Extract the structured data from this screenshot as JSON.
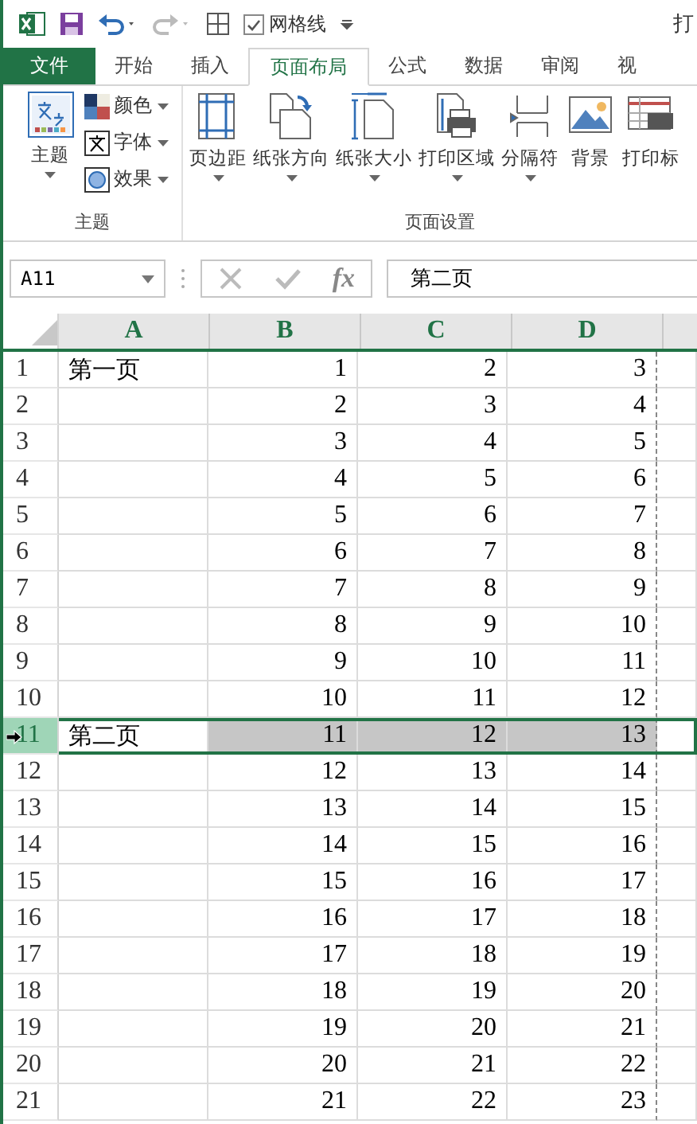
{
  "quick_access": {
    "gridlines": {
      "label": "网格线",
      "checked": true
    }
  },
  "title": "打",
  "tabs": [
    {
      "label": "文件",
      "kind": "file",
      "selected": false
    },
    {
      "label": "开始",
      "kind": "tab",
      "selected": false
    },
    {
      "label": "插入",
      "kind": "tab",
      "selected": false
    },
    {
      "label": "页面布局",
      "kind": "tab",
      "selected": true
    },
    {
      "label": "公式",
      "kind": "tab",
      "selected": false
    },
    {
      "label": "数据",
      "kind": "tab",
      "selected": false
    },
    {
      "label": "审阅",
      "kind": "tab",
      "selected": false
    },
    {
      "label": "视",
      "kind": "tab",
      "selected": false
    }
  ],
  "ribbon": {
    "theme_group": {
      "label": "主题",
      "theme_button": "主题",
      "small_buttons": [
        {
          "label": "颜色",
          "kind": "colors"
        },
        {
          "label": "字体",
          "kind": "fonts"
        },
        {
          "label": "效果",
          "kind": "effects"
        }
      ]
    },
    "page_setup_group": {
      "label": "页面设置",
      "buttons": [
        {
          "label": "页边距",
          "kind": "margins",
          "dropdown": true
        },
        {
          "label": "纸张方向",
          "kind": "orientation",
          "dropdown": true
        },
        {
          "label": "纸张大小",
          "kind": "size",
          "dropdown": true
        },
        {
          "label": "打印区域",
          "kind": "print-area",
          "dropdown": true
        },
        {
          "label": "分隔符",
          "kind": "breaks",
          "dropdown": true
        },
        {
          "label": "背景",
          "kind": "background",
          "dropdown": false
        },
        {
          "label": "打印标",
          "kind": "print-titles",
          "dropdown": false
        }
      ]
    }
  },
  "formula_bar": {
    "name_box": "A11",
    "function_button": "fx",
    "formula": "第二页"
  },
  "sheet": {
    "columns": [
      "A",
      "B",
      "C",
      "D"
    ],
    "rows": [
      {
        "header": "1",
        "cells": [
          "第一页",
          "1",
          "2",
          "3"
        ],
        "selected": false
      },
      {
        "header": "2",
        "cells": [
          "",
          "2",
          "3",
          "4"
        ],
        "selected": false
      },
      {
        "header": "3",
        "cells": [
          "",
          "3",
          "4",
          "5"
        ],
        "selected": false
      },
      {
        "header": "4",
        "cells": [
          "",
          "4",
          "5",
          "6"
        ],
        "selected": false
      },
      {
        "header": "5",
        "cells": [
          "",
          "5",
          "6",
          "7"
        ],
        "selected": false
      },
      {
        "header": "6",
        "cells": [
          "",
          "6",
          "7",
          "8"
        ],
        "selected": false
      },
      {
        "header": "7",
        "cells": [
          "",
          "7",
          "8",
          "9"
        ],
        "selected": false
      },
      {
        "header": "8",
        "cells": [
          "",
          "8",
          "9",
          "10"
        ],
        "selected": false
      },
      {
        "header": "9",
        "cells": [
          "",
          "9",
          "10",
          "11"
        ],
        "selected": false
      },
      {
        "header": "10",
        "cells": [
          "",
          "10",
          "11",
          "12"
        ],
        "selected": false
      },
      {
        "header": "11",
        "cells": [
          "第二页",
          "11",
          "12",
          "13"
        ],
        "selected": true
      },
      {
        "header": "12",
        "cells": [
          "",
          "12",
          "13",
          "14"
        ],
        "selected": false
      },
      {
        "header": "13",
        "cells": [
          "",
          "13",
          "14",
          "15"
        ],
        "selected": false
      },
      {
        "header": "14",
        "cells": [
          "",
          "14",
          "15",
          "16"
        ],
        "selected": false
      },
      {
        "header": "15",
        "cells": [
          "",
          "15",
          "16",
          "17"
        ],
        "selected": false
      },
      {
        "header": "16",
        "cells": [
          "",
          "16",
          "17",
          "18"
        ],
        "selected": false
      },
      {
        "header": "17",
        "cells": [
          "",
          "17",
          "18",
          "19"
        ],
        "selected": false
      },
      {
        "header": "18",
        "cells": [
          "",
          "18",
          "19",
          "20"
        ],
        "selected": false
      },
      {
        "header": "19",
        "cells": [
          "",
          "19",
          "20",
          "21"
        ],
        "selected": false
      },
      {
        "header": "20",
        "cells": [
          "",
          "20",
          "21",
          "22"
        ],
        "selected": false
      },
      {
        "header": "21",
        "cells": [
          "",
          "21",
          "22",
          "23"
        ],
        "selected": false
      }
    ]
  }
}
